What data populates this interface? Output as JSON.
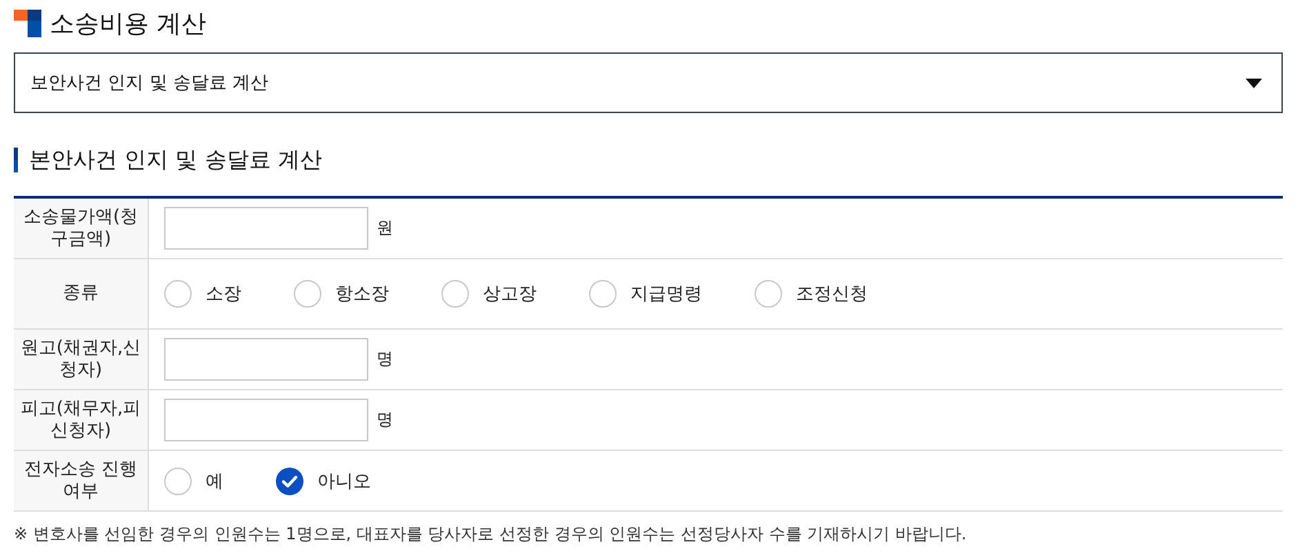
{
  "title": "소송비용 계산",
  "dropdown": {
    "value": "보안사건 인지 및 송달료 계산"
  },
  "section_title": "본안사건 인지 및 송달료 계산",
  "form_rows": [
    {
      "kind": "input",
      "label": "소송물가액(청구금액)",
      "unit": "원"
    },
    {
      "kind": "radio",
      "label": "종류",
      "options": [
        {
          "label": "소장",
          "selected": false
        },
        {
          "label": "항소장",
          "selected": false
        },
        {
          "label": "상고장",
          "selected": false
        },
        {
          "label": "지급명령",
          "selected": false
        },
        {
          "label": "조정신청",
          "selected": false
        }
      ]
    },
    {
      "kind": "input",
      "label": "원고(채권자,신청자)",
      "unit": "명"
    },
    {
      "kind": "input",
      "label": "피고(채무자,피신청자)",
      "unit": "명"
    },
    {
      "kind": "radio",
      "label": "전자소송 진행여부",
      "options": [
        {
          "label": "예",
          "selected": false
        },
        {
          "label": "아니오",
          "selected": true
        }
      ]
    }
  ],
  "note": "※ 변호사를 선임한 경우의 인원수는 1명으로, 대표자를 당사자로 선정한 경우의 인원수는 선정당사자 수를 기재하시기 바랍니다."
}
